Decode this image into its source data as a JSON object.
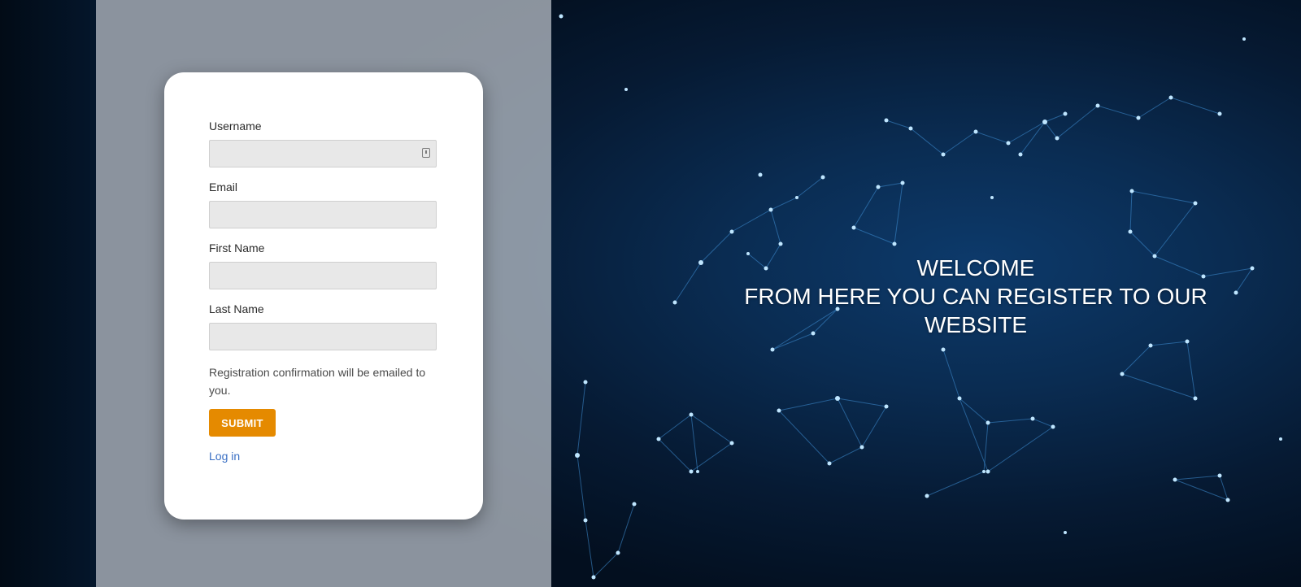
{
  "form": {
    "username_label": "Username",
    "email_label": "Email",
    "first_name_label": "First Name",
    "last_name_label": "Last Name",
    "username_value": "",
    "email_value": "",
    "first_name_value": "",
    "last_name_value": "",
    "help_text": "Registration confirmation will be emailed to you.",
    "submit_label": "SUBMIT",
    "login_link": "Log in",
    "username_icon": "password-manager-icon"
  },
  "hero": {
    "line1": "WELCOME",
    "line2": "FROM HERE YOU CAN REGISTER TO OUR WEBSITE"
  },
  "colors": {
    "accent": "#e58a00",
    "link": "#3a6fc4",
    "background": "#0a2c52"
  }
}
